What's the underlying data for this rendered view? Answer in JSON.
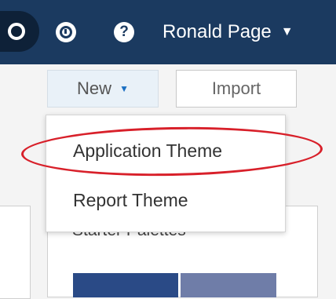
{
  "header": {
    "user_name": "Ronald Page",
    "user_caret": "▼",
    "help_glyph": "?",
    "icons": [
      "search-icon",
      "history-icon",
      "help-icon"
    ],
    "background_color": "#1b3a60"
  },
  "toolbar": {
    "new_label": "New",
    "new_caret": "▼",
    "import_label": "Import"
  },
  "new_menu": {
    "items": [
      {
        "label": "Application Theme",
        "highlighted": true
      },
      {
        "label": "Report Theme",
        "highlighted": false
      }
    ]
  },
  "content": {
    "section_title": "Starter Palettes",
    "swatch_colors": [
      "#2a4a86",
      "#6f7da8"
    ]
  },
  "annotation": {
    "color": "#d8202a"
  }
}
